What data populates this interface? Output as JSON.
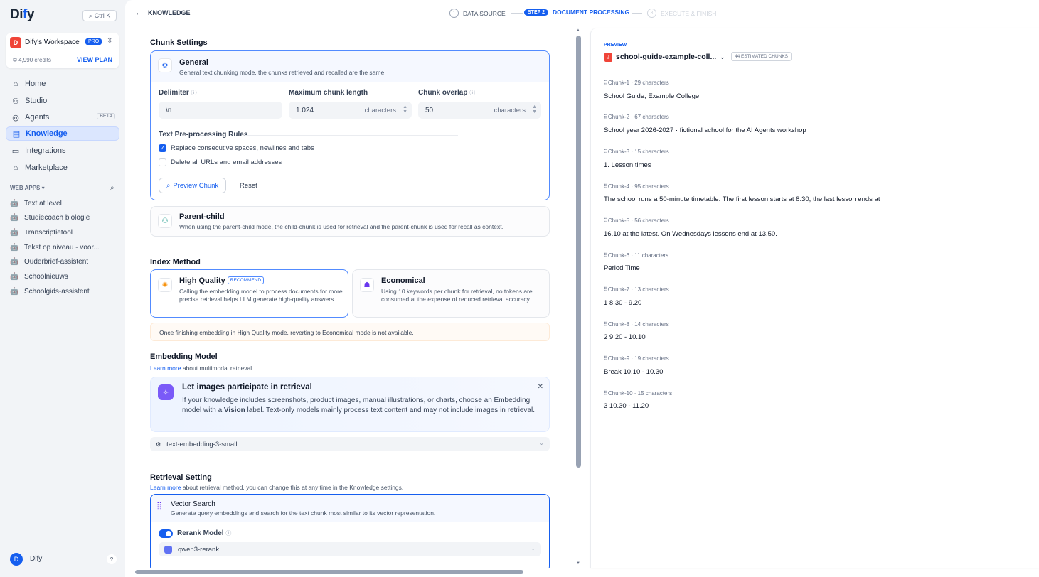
{
  "app": {
    "logo": "Dify",
    "search_shortcut": "Ctrl K"
  },
  "workspace": {
    "name": "Dify's Workspace",
    "plan": "PRO",
    "credits": "4,990 credits",
    "view_plan": "VIEW PLAN"
  },
  "nav": [
    {
      "label": "Home",
      "icon": "home-icon"
    },
    {
      "label": "Studio",
      "icon": "studio-icon"
    },
    {
      "label": "Agents",
      "icon": "agents-icon",
      "badge": "BETA"
    },
    {
      "label": "Knowledge",
      "icon": "knowledge-icon",
      "active": true
    },
    {
      "label": "Integrations",
      "icon": "integrations-icon"
    },
    {
      "label": "Marketplace",
      "icon": "marketplace-icon"
    }
  ],
  "web_apps": {
    "title": "WEB APPS",
    "items": [
      "Text at level",
      "Studiecoach biologie",
      "Transcriptietool",
      "Tekst op niveau - voor...",
      "Ouderbrief-assistent",
      "Schoolnieuws",
      "Schoolgids-assistent"
    ]
  },
  "user": {
    "initial": "D",
    "name": "Dify",
    "help": "?"
  },
  "header": {
    "back_label": "KNOWLEDGE",
    "steps": [
      {
        "num": "1",
        "label": "DATA SOURCE"
      },
      {
        "num": "STEP 2",
        "label": "DOCUMENT PROCESSING"
      },
      {
        "num": "3",
        "label": "EXECUTE & FINISH"
      }
    ]
  },
  "chunk_settings": {
    "title": "Chunk Settings",
    "general": {
      "title": "General",
      "desc": "General text chunking mode, the chunks retrieved and recalled are the same."
    },
    "delimiter": {
      "label": "Delimiter",
      "value": "\\n"
    },
    "max_length": {
      "label": "Maximum chunk length",
      "value": "1.024",
      "unit": "characters"
    },
    "overlap": {
      "label": "Chunk overlap",
      "value": "50",
      "unit": "characters"
    },
    "rules_title": "Text Pre-processing Rules",
    "rule1": "Replace consecutive spaces, newlines and tabs",
    "rule2": "Delete all URLs and email addresses",
    "preview_btn": "Preview Chunk",
    "reset_btn": "Reset",
    "parent_child": {
      "title": "Parent-child",
      "desc": "When using the parent-child mode, the child-chunk is used for retrieval and the parent-chunk is used for recall as context."
    }
  },
  "index_method": {
    "title": "Index Method",
    "high_quality": {
      "title": "High Quality",
      "badge": "RECOMMEND",
      "desc": "Calling the embedding model to process documents for more precise retrieval helps LLM generate high-quality answers."
    },
    "economical": {
      "title": "Economical",
      "desc": "Using 10 keywords per chunk for retrieval, no tokens are consumed at the expense of reduced retrieval accuracy."
    },
    "warning": "Once finishing embedding in High Quality mode, reverting to Economical mode is not available."
  },
  "embedding": {
    "title": "Embedding Model",
    "learn_more": "Learn more",
    "desc": " about multimodal retrieval.",
    "banner_title": "Let images participate in retrieval",
    "banner_desc_1": "If your knowledge includes screenshots, product images, manual illustrations, or charts, choose an Embedding model with a ",
    "banner_vision": "Vision",
    "banner_desc_2": " label. Text-only models mainly process text content and may not include images in retrieval.",
    "model": "text-embedding-3-small"
  },
  "retrieval": {
    "title": "Retrieval Setting",
    "learn_more": "Learn more",
    "desc": " about retrieval method, you can change this at any time in the Knowledge settings.",
    "vector": {
      "title": "Vector Search",
      "desc": "Generate query embeddings and search for the text chunk most similar to its vector representation."
    },
    "rerank_label": "Rerank Model",
    "rerank_model": "qwen3-rerank"
  },
  "preview": {
    "label": "PREVIEW",
    "file": "school-guide-example-coll...",
    "estimated": "44 ESTIMATED CHUNKS",
    "chunks": [
      {
        "id": "Chunk-1",
        "chars": "29 characters",
        "text": "School Guide, Example College"
      },
      {
        "id": "Chunk-2",
        "chars": "67 characters",
        "text": "School year 2026-2027 · fictional school for the AI Agents workshop"
      },
      {
        "id": "Chunk-3",
        "chars": "15 characters",
        "text": "1. Lesson times"
      },
      {
        "id": "Chunk-4",
        "chars": "95 characters",
        "text": "The school runs a 50-minute timetable. The first lesson starts at 8.30, the last lesson ends at"
      },
      {
        "id": "Chunk-5",
        "chars": "56 characters",
        "text": "16.10 at the latest. On Wednesdays lessons end at 13.50."
      },
      {
        "id": "Chunk-6",
        "chars": "11 characters",
        "text": "Period Time"
      },
      {
        "id": "Chunk-7",
        "chars": "13 characters",
        "text": "1 8.30 - 9.20"
      },
      {
        "id": "Chunk-8",
        "chars": "14 characters",
        "text": "2 9.20 - 10.10"
      },
      {
        "id": "Chunk-9",
        "chars": "19 characters",
        "text": "Break 10.10 - 10.30"
      },
      {
        "id": "Chunk-10",
        "chars": "15 characters",
        "text": "3 10.30 - 11.20"
      }
    ]
  },
  "colors": {
    "accent": "#155eef",
    "sidebar_bg": "#f2f4f7",
    "active_bg": "#dbe6fe"
  }
}
